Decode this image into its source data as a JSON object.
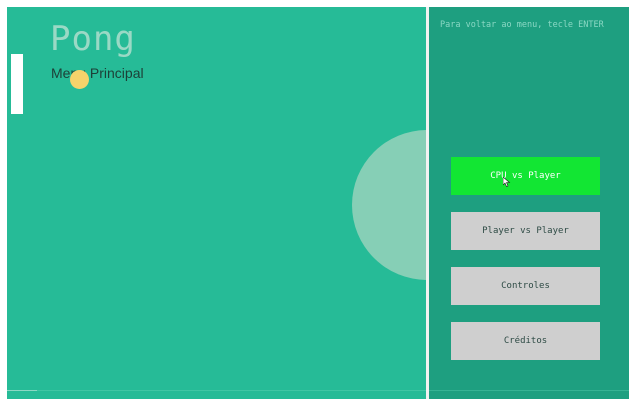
{
  "game": {
    "title": "Pong",
    "subtitle": "Menu Principal",
    "hint": "Para voltar ao menu, tecle ENTER"
  },
  "menu": {
    "selected_index": 0,
    "buttons": [
      {
        "label": "CPU vs Player",
        "active": true
      },
      {
        "label": "Player vs Player",
        "active": false
      },
      {
        "label": "Controles",
        "active": false
      },
      {
        "label": "Créditos",
        "active": false
      }
    ]
  },
  "colors": {
    "field": "#26bb97",
    "menu_panel": "#1e9f80",
    "center_circle": "#86cfb6",
    "ball": "#f6d36b",
    "paddle": "#ffffff",
    "button_active": "#12e633",
    "button_default": "#cfcfcf"
  },
  "icons": {
    "cursor": "mouse-pointer-icon"
  }
}
